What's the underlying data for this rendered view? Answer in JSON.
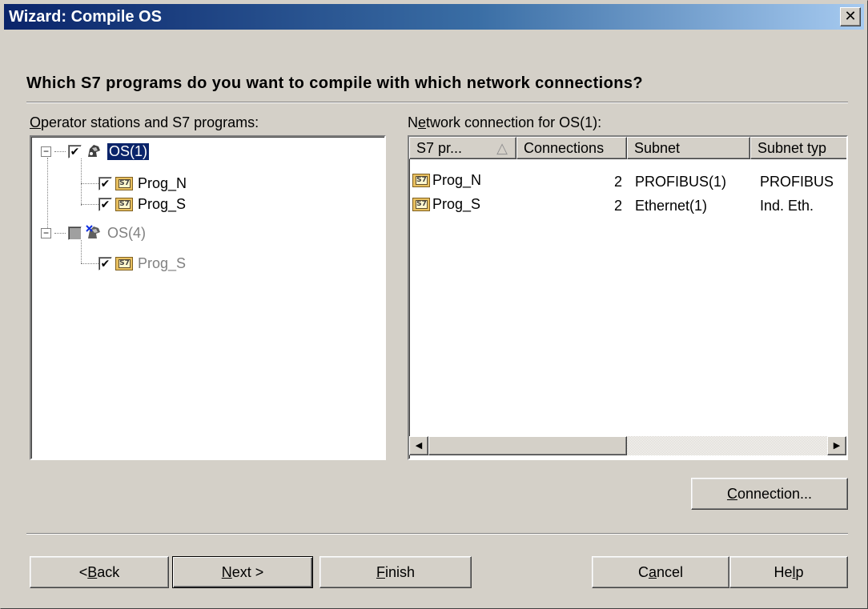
{
  "window": {
    "title": "Wizard: Compile OS",
    "close_glyph": "✕"
  },
  "heading": "Which S7 programs do you want to compile with which network connections?",
  "tree_panel": {
    "label_mnemonic": "O",
    "label_rest": "perator stations and S7 programs:",
    "nodes": [
      {
        "name": "OS(1)",
        "checked": true,
        "selected": true
      },
      {
        "name": "Prog_N",
        "checked": true,
        "icon": "S7"
      },
      {
        "name": "Prog_S",
        "checked": true,
        "icon": "S7"
      },
      {
        "name": "OS(4)",
        "checked": "indeterminate",
        "disabled": true
      },
      {
        "name": "Prog_S",
        "checked": true,
        "icon": "S7",
        "disabled": true
      }
    ],
    "collapse_glyph": "−"
  },
  "network_panel": {
    "label_pre": "N",
    "label_mnemonic": "e",
    "label_rest": "twork connection for OS(1):",
    "columns": [
      "S7 pr...",
      "Connections",
      "Subnet",
      "Subnet typ"
    ],
    "sort_glyph": "△",
    "rows": [
      {
        "program": "Prog_N",
        "connections": "2",
        "subnet": "PROFIBUS(1)",
        "subnet_type": "PROFIBUS"
      },
      {
        "program": "Prog_S",
        "connections": "2",
        "subnet": "Ethernet(1)",
        "subnet_type": "Ind. Eth."
      }
    ],
    "scroll_left_glyph": "◀",
    "scroll_right_glyph": "▶"
  },
  "buttons": {
    "connection": {
      "mnemonic": "C",
      "rest": "onnection..."
    },
    "back": {
      "pre": "< ",
      "mnemonic": "B",
      "rest": "ack"
    },
    "next": {
      "mnemonic": "N",
      "rest": "ext >"
    },
    "finish": {
      "mnemonic": "F",
      "rest": "inish"
    },
    "cancel": {
      "pre": "C",
      "mnemonic": "a",
      "rest": "ncel"
    },
    "help": {
      "pre": "He",
      "mnemonic": "l",
      "rest": "p"
    }
  },
  "checkmark_glyph": "✔",
  "s7_icon_text": "S7",
  "colors": {
    "title_start": "#0a246a",
    "title_end": "#a6caf0",
    "face": "#d4d0c8",
    "selection": "#0a246a"
  }
}
